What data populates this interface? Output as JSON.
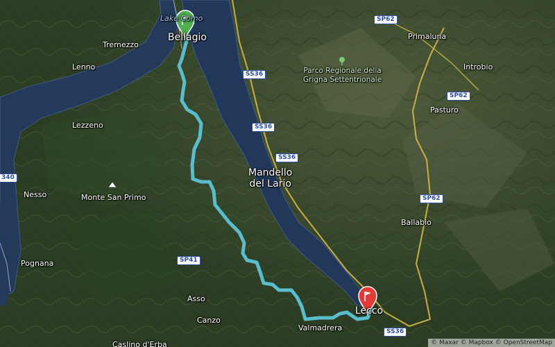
{
  "places": {
    "bellagio": "Bellagio",
    "tremezzo": "Tremezzo",
    "lenno": "Lenno",
    "lezzeno": "Lezzeno",
    "nesso": "Nesso",
    "pognana": "Pognana",
    "monte_san_primo": "Monte San Primo",
    "mandello": "Mandello\ndel Lario",
    "primaluna": "Primaluna",
    "introbio": "Introbio",
    "pasturo": "Pasturo",
    "ballabio": "Ballabio",
    "lecco": "Lecco",
    "valmadrera": "Valmadrera",
    "asso": "Asso",
    "canzo": "Canzo",
    "caslino": "Caslino d'Erba",
    "park": "Parco Regionale della\nGrigna Settentrionale",
    "lake": "Lake Como"
  },
  "roads": {
    "sp62_top": "SP62",
    "ss36_a": "SS36",
    "ss36_b": "SS36",
    "ss36_c": "SS36",
    "sp62_mid": "SP62",
    "sp62_low": "SP62",
    "sp41": "SP41",
    "ss36_bottom": "SS36",
    "left_edge": "340"
  },
  "route": {
    "color": "#5bc4d6",
    "start_marker_color": "#4caf50",
    "end_marker_color": "#e53935"
  },
  "attribution": "© Maxar © Mapbox © OpenStreetMap"
}
